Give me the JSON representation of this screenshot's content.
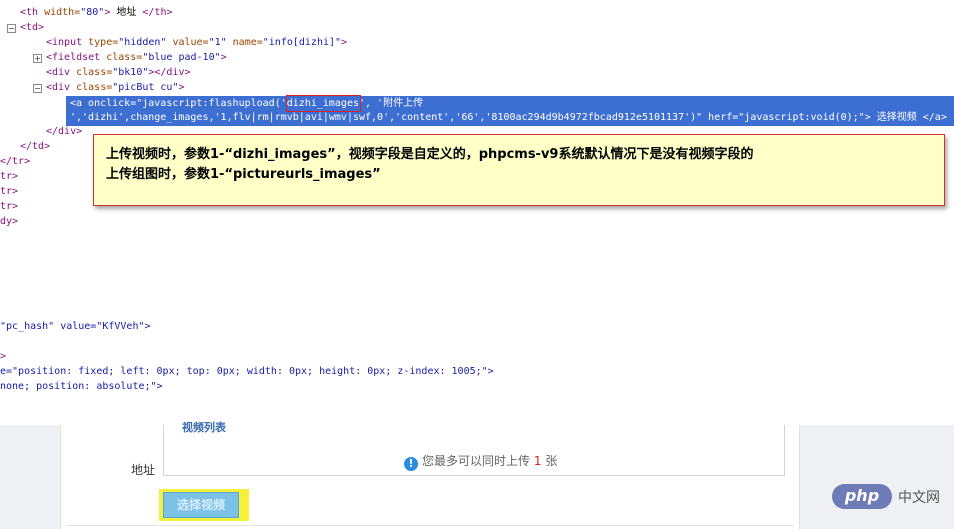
{
  "code": {
    "line1": {
      "tag_open": "<th",
      "attr": " width=",
      "val": "\"80\"",
      "tag_close": ">",
      "text": " 地址 ",
      "end": "</th>"
    },
    "line2": "<td>",
    "line3": {
      "tag_open": "<input",
      "a1": " type=",
      "v1": "\"hidden\"",
      "a2": " value=",
      "v2": "\"1\"",
      "a3": " name=",
      "v3": "\"info[dizhi]\"",
      "tag_close": ">"
    },
    "line4": {
      "tag_open": "<fieldset",
      "a1": " class=",
      "v1": "\"blue pad-10\"",
      "tag_close": ">"
    },
    "line5": {
      "tag_open": "<div",
      "a1": " class=",
      "v1": "\"bk10\"",
      "tag_close": "></div>"
    },
    "line6": {
      "tag_open": "<div",
      "a1": " class=",
      "v1": "\"picBut cu\"",
      "tag_close": ">"
    },
    "sel1": "<a onclick=\"javascript:flashupload('dizhi_images', '附件上传",
    "sel2": "','dizhi',change_images,'1,flv|rm|rmvb|avi|wmv|swf,0','content','66','8100ac294d9b4972fbcad912e5101137')\" herf=\"javascript:void(0);\"> 选择视频 </a>",
    "line7": "</div>",
    "line8": "</td>",
    "line9": "</tr>",
    "line10": "tr>",
    "line11": "tr>",
    "line12": "tr>",
    "line13": "dy>",
    "line14": "\"pc_hash\" value=\"KfVVeh\">",
    "line15": ">",
    "line16": "e=\"position: fixed; left: 0px; top: 0px; width: 0px; height: 0px; z-index: 1005;\">",
    "line17": "none; position: absolute;\">"
  },
  "note": {
    "line1": "上传视频时，参数1-“dizhi_images”，视频字段是自定义的，phpcms-v9系统默认情况下是没有视频字段的",
    "line2": "上传组图时，参数1-“pictureurls_images”"
  },
  "form": {
    "cut_title": "视频列表",
    "address_label": "地址",
    "info_prefix": "您最多可以同时上传",
    "info_count": "1",
    "info_suffix": "张",
    "select_video_button": "选择视频"
  },
  "watermark": {
    "logo": "php",
    "site": "中文网"
  }
}
